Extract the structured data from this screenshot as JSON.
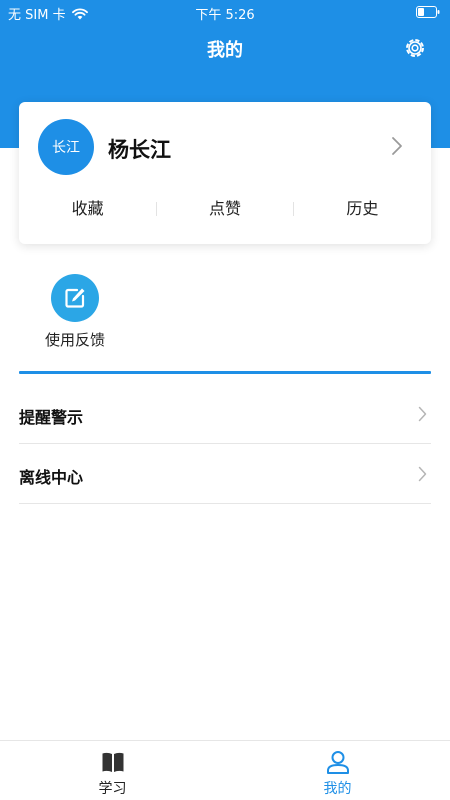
{
  "status_bar": {
    "carrier": "无 SIM 卡",
    "time": "下午 5:26"
  },
  "header": {
    "title": "我的"
  },
  "profile": {
    "avatar_text": "长江",
    "name": "杨长江",
    "stats": [
      "收藏",
      "点赞",
      "历史"
    ]
  },
  "shortcuts": [
    {
      "label": "使用反馈",
      "icon": "edit-icon"
    }
  ],
  "menu": [
    {
      "label": "提醒警示"
    },
    {
      "label": "离线中心"
    }
  ],
  "tab_bar": {
    "tabs": [
      {
        "label": "学习",
        "icon": "book-icon",
        "active": false
      },
      {
        "label": "我的",
        "icon": "person-icon",
        "active": true
      }
    ]
  },
  "colors": {
    "brand": "#1e8fe6",
    "feedback": "#2ba6e6",
    "tab_active": "#1e8fe6",
    "tab_inactive": "#222222"
  }
}
